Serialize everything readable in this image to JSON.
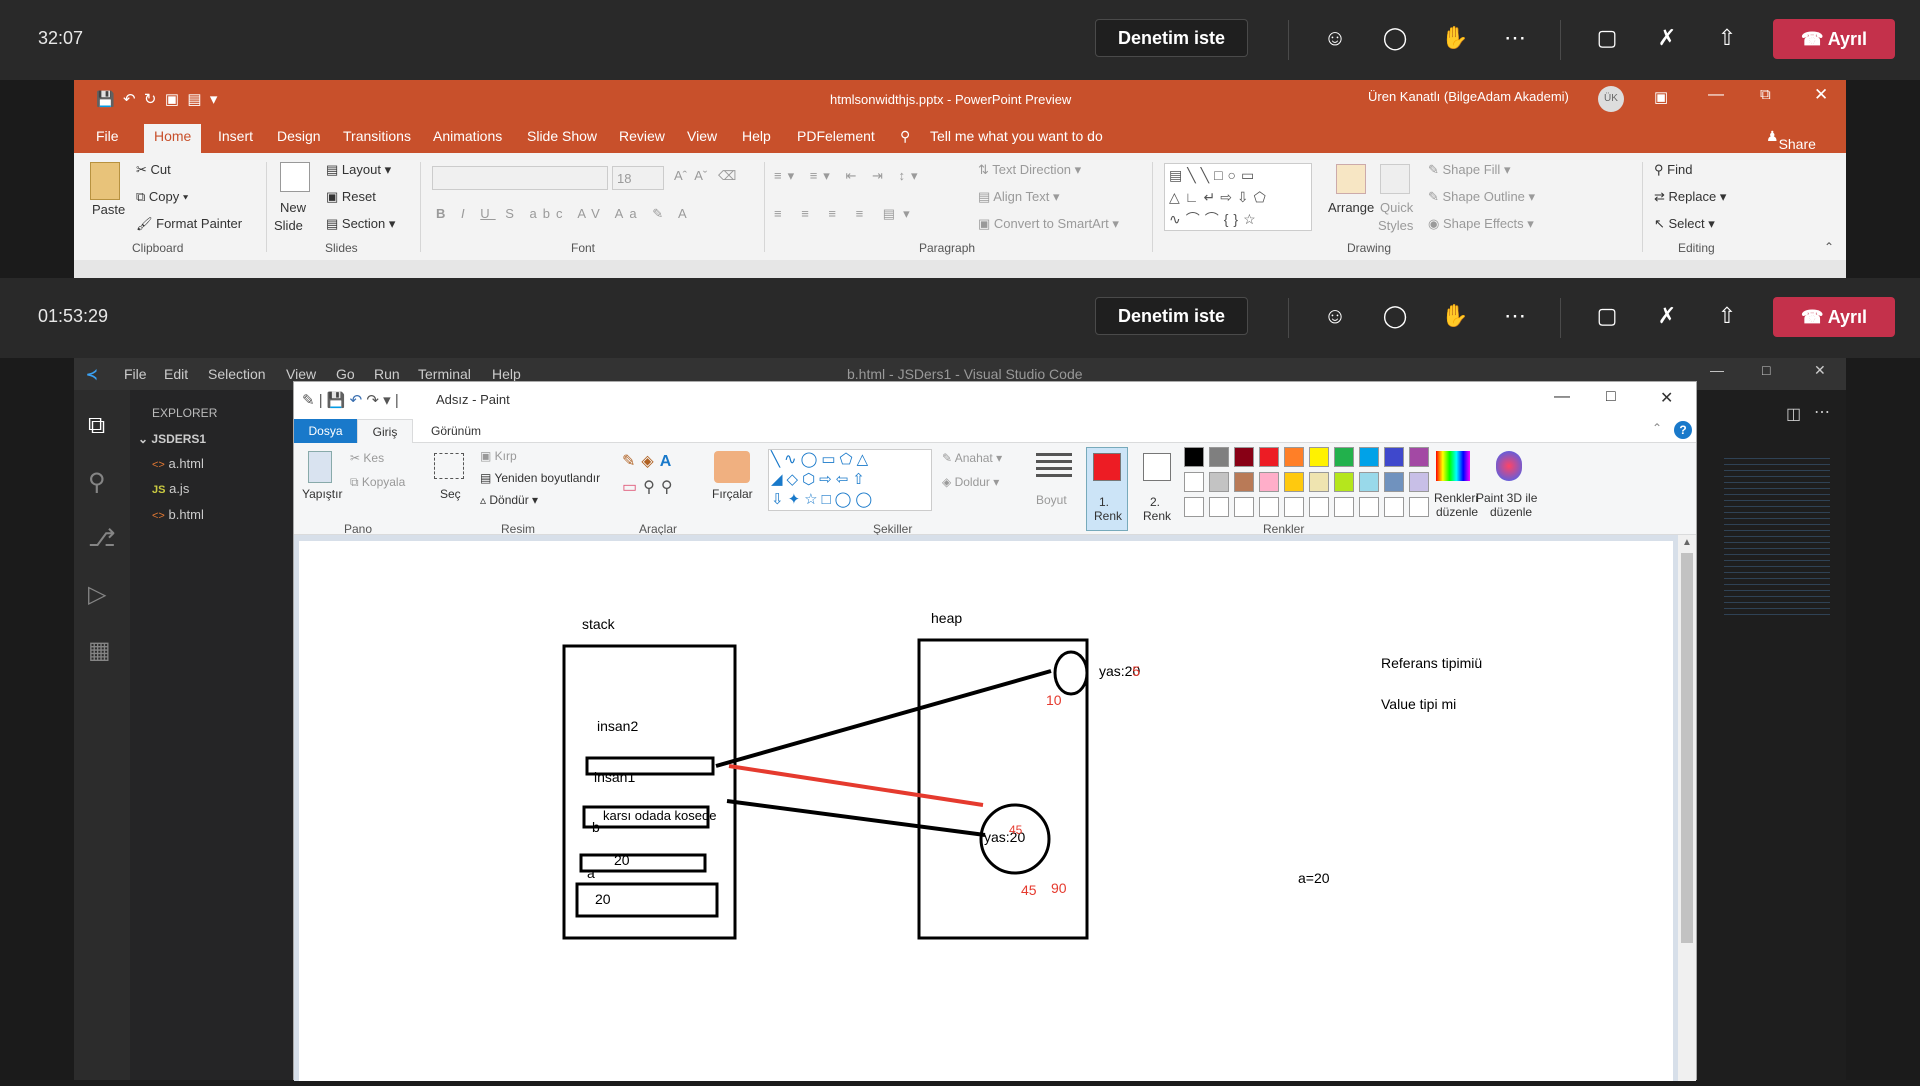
{
  "teams_top": {
    "timer": "32:07",
    "request_control": "Denetim iste",
    "leave": "Ayrıl"
  },
  "teams_bottom": {
    "timer": "01:53:29",
    "request_control": "Denetim iste",
    "leave": "Ayrıl"
  },
  "powerpoint": {
    "title": "htmlsonwidthjs.pptx - PowerPoint Preview",
    "user": "Üren Kanatlı (BilgeAdam Akademi)",
    "user_initials": "ÜK",
    "share": "Share",
    "tabs": [
      "File",
      "Home",
      "Insert",
      "Design",
      "Transitions",
      "Animations",
      "Slide Show",
      "Review",
      "View",
      "Help",
      "PDFelement"
    ],
    "tell_me": "Tell me what you want to do",
    "clipboard": {
      "paste": "Paste",
      "cut": "Cut",
      "copy": "Copy",
      "format_painter": "Format Painter",
      "group": "Clipboard"
    },
    "slides": {
      "new_slide": "New",
      "new_slide2": "Slide",
      "layout": "Layout",
      "reset": "Reset",
      "section": "Section",
      "group": "Slides"
    },
    "font": {
      "size": "18",
      "group": "Font"
    },
    "paragraph": {
      "text_direction": "Text Direction",
      "align_text": "Align Text",
      "convert": "Convert to SmartArt",
      "group": "Paragraph"
    },
    "drawing": {
      "arrange": "Arrange",
      "quick": "Quick",
      "styles": "Styles",
      "shape_fill": "Shape Fill",
      "shape_outline": "Shape Outline",
      "shape_effects": "Shape Effects",
      "group": "Drawing"
    },
    "editing": {
      "find": "Find",
      "replace": "Replace",
      "select": "Select",
      "group": "Editing"
    }
  },
  "vscode": {
    "menu": [
      "File",
      "Edit",
      "Selection",
      "View",
      "Go",
      "Run",
      "Terminal",
      "Help"
    ],
    "title": "b.html - JSDers1 - Visual Studio Code",
    "explorer": "EXPLORER",
    "folder": "JSDERS1",
    "files": [
      {
        "icon": "<>",
        "name": "a.html"
      },
      {
        "icon": "JS",
        "name": "a.js"
      },
      {
        "icon": "<>",
        "name": "b.html"
      }
    ]
  },
  "paint": {
    "title": "Adsız - Paint",
    "tabs": [
      "Dosya",
      "Giriş",
      "Görünüm"
    ],
    "pano": {
      "paste": "Yapıştır",
      "cut": "Kes",
      "copy": "Kopyala",
      "group": "Pano"
    },
    "resim": {
      "select": "Seç",
      "crop": "Kırp",
      "resize": "Yeniden boyutlandır",
      "rotate": "Döndür",
      "group": "Resim"
    },
    "araclar": {
      "group": "Araçlar"
    },
    "brushes": "Fırçalar",
    "sekiller": {
      "outline": "Anahat",
      "fill": "Doldur",
      "group": "Şekiller"
    },
    "size": "Boyut",
    "color1": "1.",
    "color1b": "Renk",
    "color2": "2.",
    "color2b": "Renk",
    "edit_colors": "Renkleri",
    "edit_colors2": "düzenle",
    "paint3d": "Paint 3D ile",
    "paint3d2": "düzenle",
    "renkler": "Renkler",
    "palette": [
      "#000000",
      "#7f7f7f",
      "#880015",
      "#ed1c24",
      "#ff7f27",
      "#fff200",
      "#22b14c",
      "#00a2e8",
      "#3f48cc",
      "#a349a4",
      "#ffffff",
      "#c3c3c3",
      "#b97a57",
      "#ffaec9",
      "#ffc90e",
      "#efe4b0",
      "#b5e61d",
      "#99d9ea",
      "#7092be",
      "#c8bfe7"
    ],
    "color1_value": "#ed1c24"
  },
  "drawing": {
    "stack": "stack",
    "heap": "heap",
    "insan2": "insan2",
    "insan1": "insan1",
    "insan1_value": "karsı odada kosede",
    "b": "b",
    "b_value": "20",
    "a": "a",
    "a_value": "20",
    "yas_top": "yas:20",
    "yas_top_red": "5",
    "ten": "10",
    "yas_circle": "yas:20",
    "yas_circle_red": "45",
    "n45": "45",
    "n90": "90",
    "ref": "Referans tipimiü",
    "value": "Value tipi mi",
    "a_eq": "a=20"
  }
}
